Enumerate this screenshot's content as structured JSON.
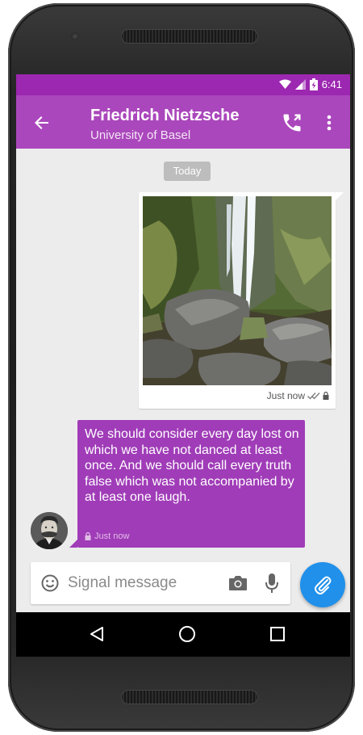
{
  "status_bar": {
    "time": "6:41"
  },
  "toolbar": {
    "title": "Friedrich Nietzsche",
    "subtitle": "University of Basel",
    "back_icon": "arrow-left-icon",
    "call_icon": "phone-icon",
    "menu_icon": "more-vert-icon"
  },
  "conversation": {
    "date_divider": "Today",
    "outgoing": {
      "attachment": "waterfall photo",
      "timestamp": "Just now"
    },
    "incoming": {
      "text": "We should consider every day lost on which we have not danced at least once. And we should call every truth false which was not accompanied by at least one laugh.",
      "timestamp": "Just now"
    }
  },
  "compose": {
    "placeholder": "Signal message",
    "emoji_icon": "emoji-icon",
    "camera_icon": "camera-icon",
    "mic_icon": "microphone-icon",
    "attach_icon": "paperclip-icon"
  },
  "colors": {
    "status_bar": "#9c27b0",
    "toolbar": "#ab47bc",
    "incoming_bubble": "#a03cb8",
    "attach_button": "#2090ea",
    "chat_background": "#ececec"
  }
}
